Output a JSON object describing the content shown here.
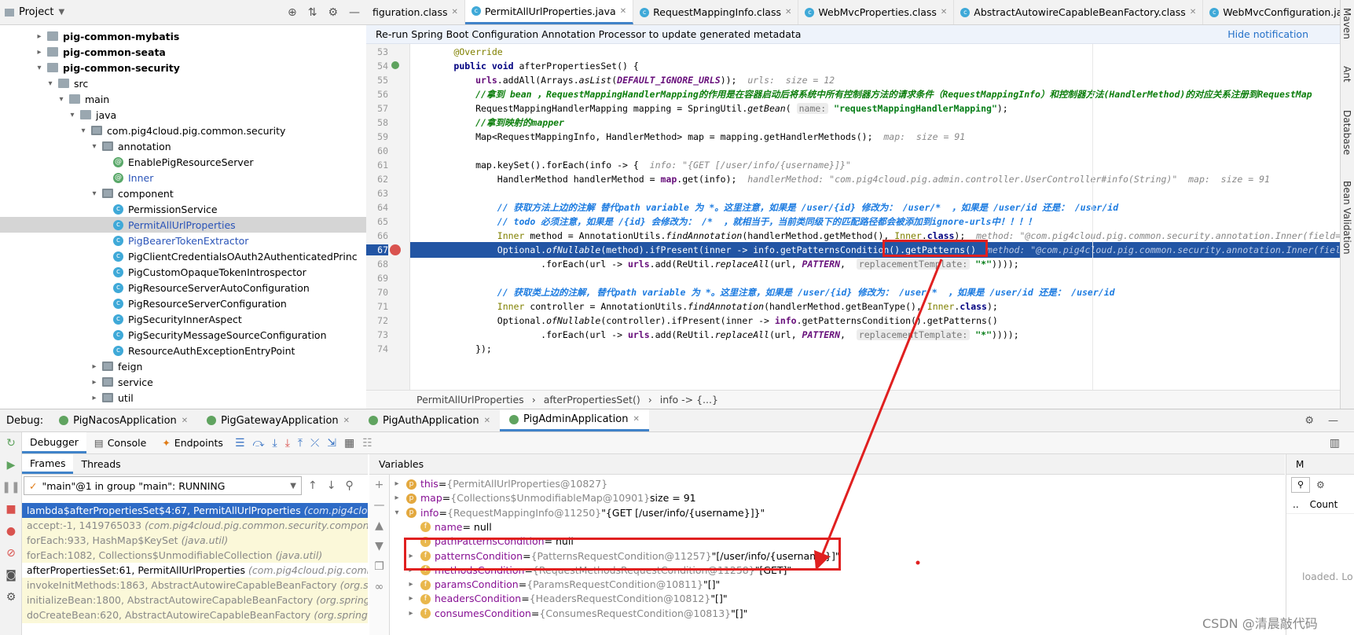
{
  "project": {
    "title": "Project"
  },
  "tree": [
    {
      "label": "pig-common-mybatis",
      "indent": 3,
      "arrow": "▸",
      "icon": "folder",
      "bold": true
    },
    {
      "label": "pig-common-seata",
      "indent": 3,
      "arrow": "▸",
      "icon": "folder",
      "bold": true
    },
    {
      "label": "pig-common-security",
      "indent": 3,
      "arrow": "▾",
      "icon": "folder",
      "bold": true
    },
    {
      "label": "src",
      "indent": 4,
      "arrow": "▾",
      "icon": "folder"
    },
    {
      "label": "main",
      "indent": 5,
      "arrow": "▾",
      "icon": "folder"
    },
    {
      "label": "java",
      "indent": 6,
      "arrow": "▾",
      "icon": "folder"
    },
    {
      "label": "com.pig4cloud.pig.common.security",
      "indent": 7,
      "arrow": "▾",
      "icon": "pkg"
    },
    {
      "label": "annotation",
      "indent": 8,
      "arrow": "▾",
      "icon": "pkg"
    },
    {
      "label": "EnablePigResourceServer",
      "indent": 9,
      "arrow": "",
      "icon": "ann"
    },
    {
      "label": "Inner",
      "indent": 9,
      "arrow": "",
      "icon": "ann",
      "blue": true
    },
    {
      "label": "component",
      "indent": 8,
      "arrow": "▾",
      "icon": "pkg"
    },
    {
      "label": "PermissionService",
      "indent": 9,
      "arrow": "",
      "icon": "cls"
    },
    {
      "label": "PermitAllUrlProperties",
      "indent": 9,
      "arrow": "",
      "icon": "cls",
      "blue": true,
      "selected": true
    },
    {
      "label": "PigBearerTokenExtractor",
      "indent": 9,
      "arrow": "",
      "icon": "cls",
      "blue": true
    },
    {
      "label": "PigClientCredentialsOAuth2AuthenticatedPrinc",
      "indent": 9,
      "arrow": "",
      "icon": "cls"
    },
    {
      "label": "PigCustomOpaqueTokenIntrospector",
      "indent": 9,
      "arrow": "",
      "icon": "cls"
    },
    {
      "label": "PigResourceServerAutoConfiguration",
      "indent": 9,
      "arrow": "",
      "icon": "cls"
    },
    {
      "label": "PigResourceServerConfiguration",
      "indent": 9,
      "arrow": "",
      "icon": "cls"
    },
    {
      "label": "PigSecurityInnerAspect",
      "indent": 9,
      "arrow": "",
      "icon": "cls"
    },
    {
      "label": "PigSecurityMessageSourceConfiguration",
      "indent": 9,
      "arrow": "",
      "icon": "cls"
    },
    {
      "label": "ResourceAuthExceptionEntryPoint",
      "indent": 9,
      "arrow": "",
      "icon": "cls"
    },
    {
      "label": "feign",
      "indent": 8,
      "arrow": "▸",
      "icon": "pkg"
    },
    {
      "label": "service",
      "indent": 8,
      "arrow": "▸",
      "icon": "pkg"
    },
    {
      "label": "util",
      "indent": 8,
      "arrow": "▸",
      "icon": "pkg"
    },
    {
      "label": "resources",
      "indent": 6,
      "arrow": "▸",
      "icon": "folder"
    }
  ],
  "tabs": [
    {
      "label": "figuration.class",
      "active": false
    },
    {
      "label": "PermitAllUrlProperties.java",
      "active": true
    },
    {
      "label": "RequestMappingInfo.class",
      "active": false
    },
    {
      "label": "WebMvcProperties.class",
      "active": false
    },
    {
      "label": "AbstractAutowireCapableBeanFactory.class",
      "active": false
    },
    {
      "label": "WebMvcConfiguration.java",
      "active": false
    }
  ],
  "notification": {
    "text": "Re-run Spring Boot Configuration Annotation Processor to update generated metadata",
    "action": "Hide notification"
  },
  "editor": {
    "line_numbers": [
      "53",
      "54",
      "55",
      "56",
      "57",
      "58",
      "59",
      "60",
      "61",
      "62",
      "63",
      "64",
      "65",
      "66",
      "67",
      "68",
      "69",
      "70",
      "71",
      "72",
      "73",
      "74"
    ],
    "breakpoint_line": "67"
  },
  "breadcrumb": [
    "PermitAllUrlProperties",
    "afterPropertiesSet()",
    "info -> {...}"
  ],
  "debug": {
    "label": "Debug:",
    "apps": [
      "PigNacosApplication",
      "PigGatewayApplication",
      "PigAuthApplication",
      "PigAdminApplication"
    ],
    "tabs": [
      "Debugger",
      "Console",
      "Endpoints"
    ],
    "frames_tabs": [
      "Frames",
      "Threads"
    ],
    "thread": "\"main\"@1 in group \"main\": RUNNING",
    "vars_title": "Variables",
    "frames": [
      {
        "m": "lambda$afterPropertiesSet$4:67, PermitAllUrlProperties",
        "p": "(com.pig4cloud.pi",
        "style": "sel"
      },
      {
        "m": "accept:-1, 1419765033",
        "p": "(com.pig4cloud.pig.common.security.component.Pe",
        "style": "yel"
      },
      {
        "m": "forEach:933, HashMap$KeySet",
        "p": "(java.util)",
        "style": "yel"
      },
      {
        "m": "forEach:1082, Collections$UnmodifiableCollection",
        "p": "(java.util)",
        "style": "yel"
      },
      {
        "m": "afterPropertiesSet:61, PermitAllUrlProperties",
        "p": "(com.pig4cloud.pig.common.",
        "style": "dark"
      },
      {
        "m": "invokeInitMethods:1863, AbstractAutowireCapableBeanFactory",
        "p": "(org.spring",
        "style": "yel"
      },
      {
        "m": "initializeBean:1800, AbstractAutowireCapableBeanFactory",
        "p": "(org.springframe",
        "style": "yel"
      },
      {
        "m": "doCreateBean:620, AbstractAutowireCapableBeanFactory",
        "p": "(org.springframe",
        "style": "yel"
      }
    ],
    "vars": [
      {
        "name": "this",
        "val": "{PermitAllUrlProperties@10827}",
        "extra": "",
        "arrow": "▸",
        "icon": "t",
        "indent": 0
      },
      {
        "name": "map",
        "val": "{Collections$UnmodifiableMap@10901}",
        "extra": " size = 91",
        "arrow": "▸",
        "icon": "p",
        "indent": 0
      },
      {
        "name": "info",
        "val": "{RequestMappingInfo@11250}",
        "extra": " \"{GET [/user/info/{username}]}\"",
        "arrow": "▾",
        "icon": "p",
        "indent": 0
      },
      {
        "name": "name",
        "val": "",
        "extra": " = null",
        "arrow": "",
        "icon": "f",
        "indent": 1
      },
      {
        "name": "pathPatternsCondition",
        "val": "",
        "extra": " = null",
        "arrow": "",
        "icon": "f",
        "indent": 1
      },
      {
        "name": "patternsCondition",
        "val": "{PatternsRequestCondition@11257}",
        "extra": " \"[/user/info/{username}]\"",
        "arrow": "▸",
        "icon": "f",
        "indent": 1
      },
      {
        "name": "methodsCondition",
        "val": "{RequestMethodsRequestCondition@11258}",
        "extra": " \"[GET]\"",
        "arrow": "▸",
        "icon": "f",
        "indent": 1
      },
      {
        "name": "paramsCondition",
        "val": "{ParamsRequestCondition@10811}",
        "extra": " \"[]\"",
        "arrow": "▸",
        "icon": "f",
        "indent": 1
      },
      {
        "name": "headersCondition",
        "val": "{HeadersRequestCondition@10812}",
        "extra": " \"[]\"",
        "arrow": "▸",
        "icon": "f",
        "indent": 1
      },
      {
        "name": "consumesCondition",
        "val": "{ConsumesRequestCondition@10813}",
        "extra": " \"[]\"",
        "arrow": "▸",
        "icon": "f",
        "indent": 1
      }
    ],
    "right_panel": {
      "tab": "M",
      "count": "Count",
      "loaded": "loaded. Lo"
    }
  },
  "side_tools": [
    "Maven",
    "Ant",
    "Database",
    "Bean Validation"
  ],
  "watermark": "CSDN @清晨敲代码",
  "colors": {
    "annotation": "#e02020",
    "selection": "#2255a4",
    "accent": "#4083c9"
  }
}
